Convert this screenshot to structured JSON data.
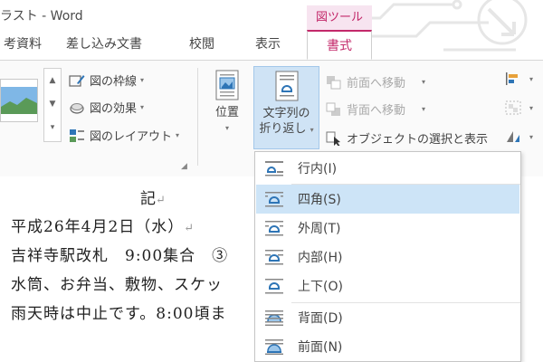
{
  "window": {
    "title": "ラスト - Word"
  },
  "context_tab_group": "図ツール",
  "tabs": [
    {
      "label": "考資料"
    },
    {
      "label": "差し込み文書"
    },
    {
      "label": "校閲"
    },
    {
      "label": "表示"
    },
    {
      "label": "書式",
      "active": true
    }
  ],
  "ribbon": {
    "picture_styles": {
      "border": "図の枠線",
      "effects": "図の効果",
      "layout": "図のレイアウト"
    },
    "arrange": {
      "position": "位置",
      "wrap_line1": "文字列の",
      "wrap_line2": "折り返し",
      "bring_forward": "前面へ移動",
      "send_backward": "背面へ移動",
      "selection_pane": "オブジェクトの選択と表示"
    }
  },
  "document": {
    "heading": "記",
    "lines": [
      "平成26年4月2日（水）",
      "吉祥寺駅改札　9:00集合　③",
      "水筒、お弁当、敷物、スケッ",
      "雨天時は中止です。8:00頃ま"
    ]
  },
  "wrap_menu": {
    "items": [
      {
        "label": "行内(I)",
        "icon": "wrap-inline-icon"
      },
      {
        "label": "四角(S)",
        "icon": "wrap-square-icon",
        "highlighted": true
      },
      {
        "label": "外周(T)",
        "icon": "wrap-tight-icon"
      },
      {
        "label": "内部(H)",
        "icon": "wrap-through-icon"
      },
      {
        "label": "上下(O)",
        "icon": "wrap-topbottom-icon"
      },
      {
        "label": "背面(D)",
        "icon": "wrap-behind-icon"
      },
      {
        "label": "前面(N)",
        "icon": "wrap-front-icon"
      }
    ]
  },
  "colors": {
    "accent": "#c3296a",
    "context_bg": "#f7e4f0",
    "menu_highlight": "#cde4f7",
    "icon_blue": "#2e75b6"
  }
}
